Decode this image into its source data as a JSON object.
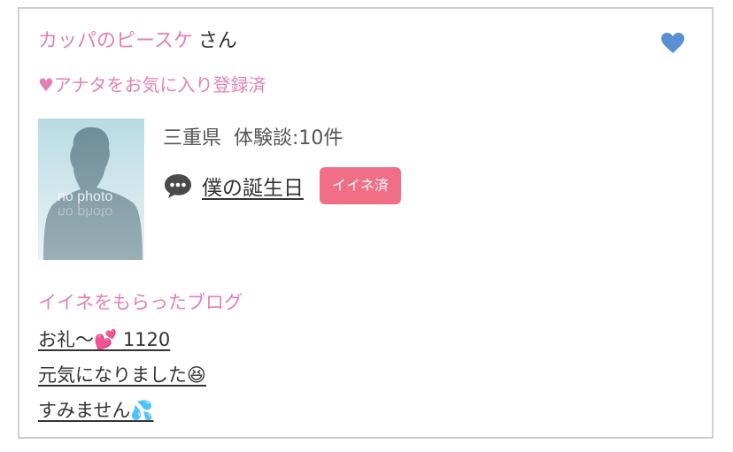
{
  "user": {
    "name": "カッパのピースケ",
    "suffix": "さん",
    "favorite_status": "♥アナタをお気に入り登録済",
    "prefecture": "三重県",
    "experience_count": "体験談:10件",
    "avatar_placeholder": "no photo"
  },
  "post": {
    "title": "僕の誕生日",
    "like_badge": "イイネ済"
  },
  "liked_blogs": {
    "heading": "イイネをもらったブログ",
    "items": [
      "お礼〜💕 1120",
      "元気になりました😆",
      "すみません💦"
    ]
  },
  "colors": {
    "pink_text": "#e37fb6",
    "heart_blue": "#5b8fd4",
    "badge": "#f06f86"
  },
  "icons": {
    "favorite": "heart-icon",
    "comment": "speech-bubble-icon"
  }
}
